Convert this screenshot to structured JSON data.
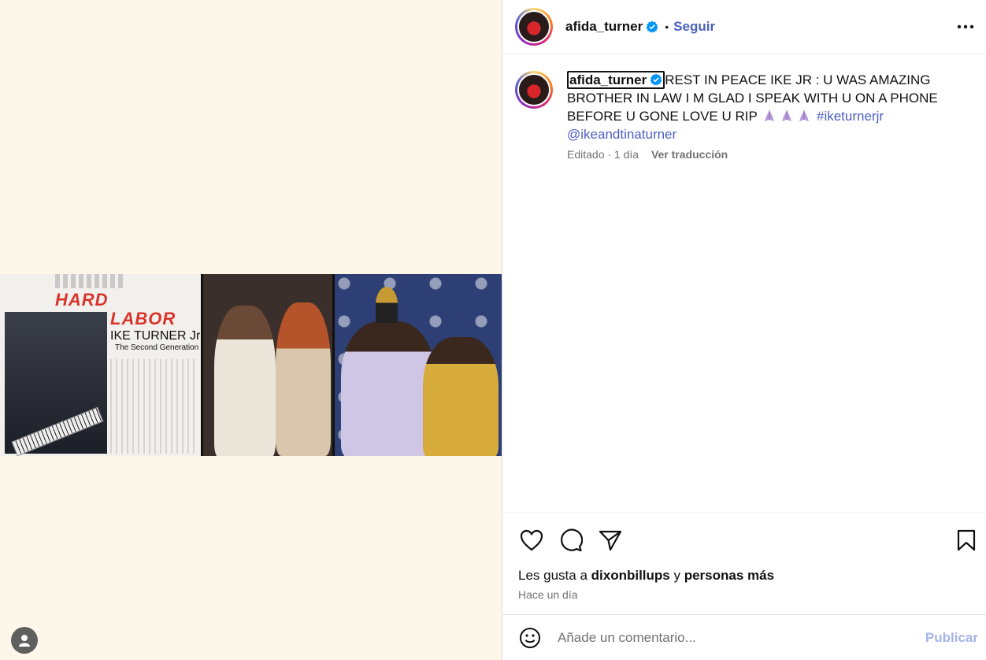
{
  "post": {
    "username": "afida_turner",
    "follow_label": "Seguir",
    "dot": "•",
    "more_label": "•••",
    "caption_text": "REST IN PEACE IKE JR : U WAS AMAZING BROTHER IN LAW I M GLAD I SPEAK WITH U ON A PHONE BEFORE U GONE LOVE U RIP",
    "hashtag": "#iketurnerjr",
    "mention": "@ikeandtinaturner",
    "edited_label": "Editado · 1 día",
    "translate_label": "Ver traducción",
    "likes_prefix": "Les gusta a",
    "likes_user": "dixonbillups",
    "likes_connector": "y",
    "likes_suffix": "personas más",
    "time_ago": "Hace un día"
  },
  "media": {
    "album_title_1": "HARD",
    "album_title_2": "LABOR",
    "album_name": "IKE TURNER Jr",
    "album_subtitle": "The Second Generation"
  },
  "comment": {
    "placeholder": "Añade un comentario...",
    "publish_label": "Publicar"
  },
  "colors": {
    "link": "#4a5fc1",
    "verified": "#0095f6",
    "muted": "#737373",
    "publish_disabled": "#a5b4e9",
    "media_bg": "#fdf7e9"
  },
  "icons": [
    "verified-badge-icon",
    "more-options-icon",
    "like-heart-icon",
    "comment-bubble-icon",
    "share-paper-plane-icon",
    "save-bookmark-icon",
    "emoji-icon",
    "praying-hands-emoji-icon",
    "user-avatar-icon"
  ]
}
